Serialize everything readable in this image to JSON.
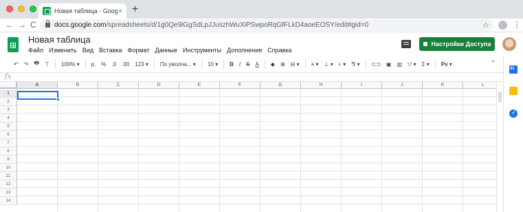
{
  "browser": {
    "tab_title": "Новая таблица - Google Табл",
    "tab_close": "×",
    "new_tab": "+",
    "nav_back": "←",
    "nav_forward": "→",
    "nav_reload": "C",
    "url_host": "docs.google.com",
    "url_path": "/spreadsheets/d/1g0Qe9lGgSdLpJJuszhWuXiPSwpoRqGfFLkD4aoeEOSY/edit#gid=0",
    "star": "☆",
    "menu": "⋮"
  },
  "doc": {
    "title": "Новая таблица",
    "menu": [
      "Файл",
      "Изменить",
      "Вид",
      "Вставка",
      "Формат",
      "Данные",
      "Инструменты",
      "Дополнения",
      "Справка"
    ],
    "share_label": "Настройки Доступа"
  },
  "toolbar": {
    "undo": "↶",
    "redo": "↷",
    "print": "🖶",
    "paint": "⊤",
    "zoom": "100%  ▾",
    "currency": "р.",
    "percent": "%",
    "dec_less": ".0",
    "dec_more": ".00",
    "format_more": "123 ▾",
    "font": "По умолча...  ▾",
    "size": "10  ▾",
    "bold": "B",
    "italic": "I",
    "strike": "S",
    "underline": "A",
    "fill": "◆",
    "borders": "⊞",
    "merge": "⊟ ▾",
    "halign": "≡ ▾",
    "valign": "⊥ ▾",
    "wrap": "⊦ ▾",
    "rotate": "⅋ ▾",
    "link": "⊂⊃",
    "comment": "▣",
    "chart": "▥",
    "filter": "▽ ▾",
    "functions": "Σ ▾",
    "input": "Pv ▾",
    "collapse": "⌃"
  },
  "formula_bar": {
    "fx": "fx",
    "value": ""
  },
  "grid": {
    "columns": [
      "A",
      "B",
      "C",
      "D",
      "E",
      "F",
      "G",
      "H",
      "I",
      "J",
      "K",
      "L"
    ],
    "rows": [
      "1",
      "2",
      "3",
      "4",
      "5",
      "6",
      "7",
      "8",
      "9",
      "10",
      "11",
      "12",
      "13",
      "14"
    ],
    "selected_cell": "A1"
  },
  "colors": {
    "accent": "#1a73e8",
    "share_button": "#188038",
    "sheets_green": "#0f9d58"
  },
  "side_panel": [
    "calendar-icon",
    "keep-icon",
    "tasks-icon"
  ]
}
